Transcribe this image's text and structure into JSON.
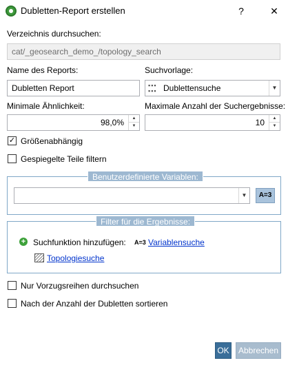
{
  "window": {
    "title": "Dubletten-Report erstellen",
    "help_label": "?",
    "close_label": "✕"
  },
  "directory": {
    "label": "Verzeichnis durchsuchen:",
    "value": "cat/_geosearch_demo_/topology_search"
  },
  "report_name": {
    "label": "Name des Reports:",
    "value": "Dubletten Report"
  },
  "template": {
    "label": "Suchvorlage:",
    "value": "Dublettensuche"
  },
  "similarity": {
    "label": "Minimale Ähnlichkeit:",
    "value": "98,0%"
  },
  "max_results": {
    "label": "Maximale Anzahl der Suchergebnisse:",
    "value": "10"
  },
  "options": {
    "size_dependent": {
      "label": "Größenabhängig",
      "checked": true
    },
    "mirrored": {
      "label": "Gespiegelte Teile filtern",
      "checked": false
    },
    "preferred_only": {
      "label": "Nur Vorzugsreihen durchsuchen",
      "checked": false
    },
    "sort_by_count": {
      "label": "Nach der Anzahl der Dubletten sortieren",
      "checked": false
    }
  },
  "variables_group": {
    "title": "Benutzerdefinierte Variablen:",
    "combo_value": "",
    "button_label": "A=3"
  },
  "filter_group": {
    "title": "Filter für die Ergebnisse:",
    "add_label": "Suchfunktion hinzufügen:",
    "variable_icon_label": "A=3",
    "variable_link": "Variablensuche",
    "topology_link": "Topologiesuche"
  },
  "buttons": {
    "ok": "OK",
    "cancel": "Abbrechen"
  }
}
